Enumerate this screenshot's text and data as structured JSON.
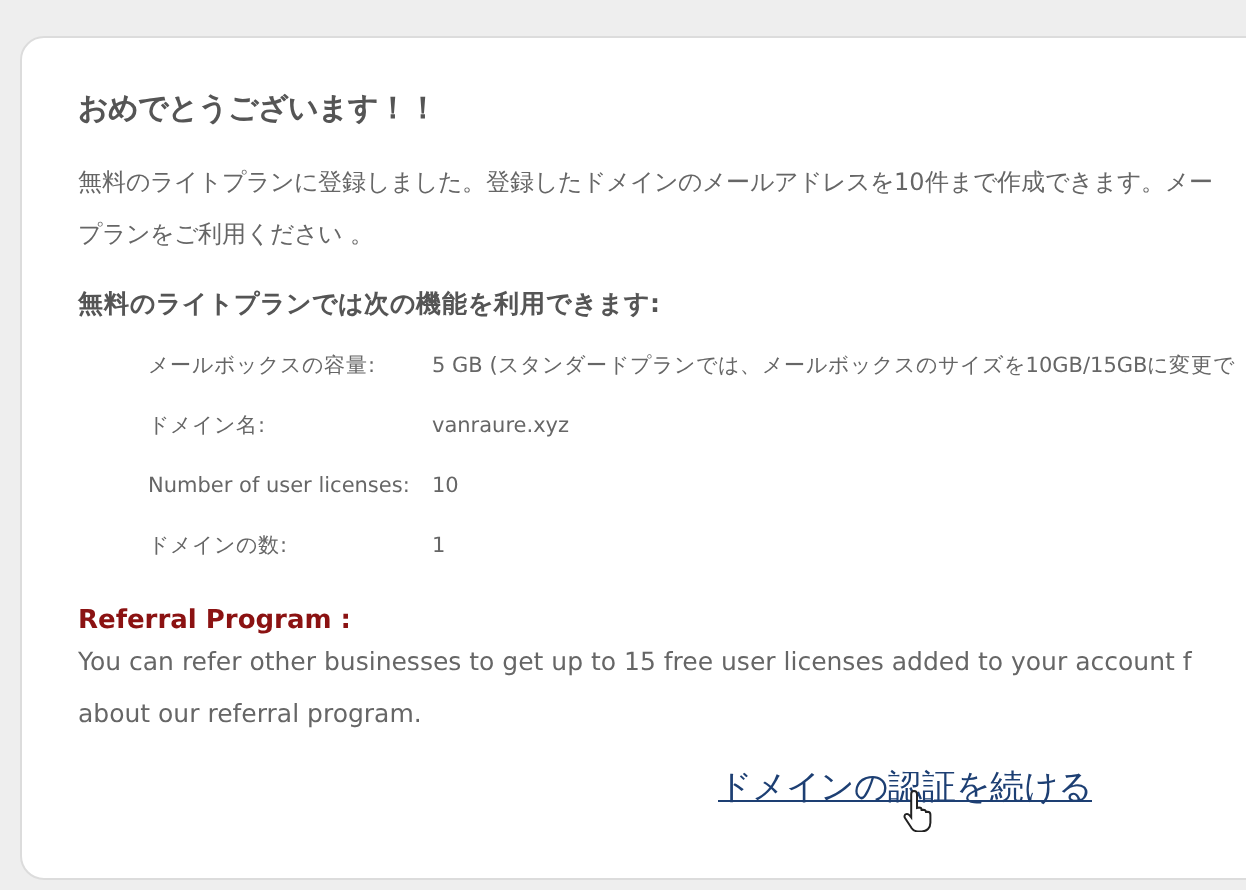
{
  "title": "おめでとうございます！！",
  "intro_lines": [
    "無料のライトプランに登録しました。登録したドメインのメールアドレスを10件まで作成できます。メー",
    "プランをご利用ください 。"
  ],
  "features_heading": "無料のライトプランでは次の機能を利用できます:",
  "features": [
    {
      "label": "メールボックスの容量:",
      "value": "5 GB (スタンダードプランでは、メールボックスのサイズを10GB/15GBに変更で"
    },
    {
      "label": "ドメイン名:",
      "value": "vanraure.xyz"
    },
    {
      "label": "Number of user licenses:",
      "value": "10"
    },
    {
      "label": "ドメインの数:",
      "value": "1"
    }
  ],
  "referral": {
    "heading": "Referral Program :",
    "lines": [
      "You can refer other businesses to get up to 15 free user licenses added to your account f",
      "about our referral program."
    ]
  },
  "continue_link": "ドメインの認証を続ける"
}
